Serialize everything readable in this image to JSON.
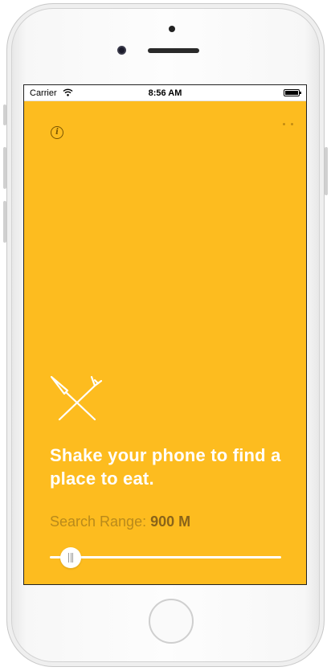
{
  "status_bar": {
    "carrier": "Carrier",
    "time": "8:56 AM"
  },
  "icons": {
    "info": "info-icon",
    "wifi": "wifi-icon",
    "battery": "battery-icon",
    "utensils": "fork-knife-icon",
    "more": "dots-icon"
  },
  "main": {
    "headline": "Shake your phone to find a place to eat.",
    "range_label": "Search Range:",
    "range_value": "900 M",
    "slider_level": 0.05
  },
  "colors": {
    "background": "#fdbc1f",
    "text_white": "#ffffff",
    "range_label": "#b98a1b",
    "range_value": "#8a6419"
  }
}
